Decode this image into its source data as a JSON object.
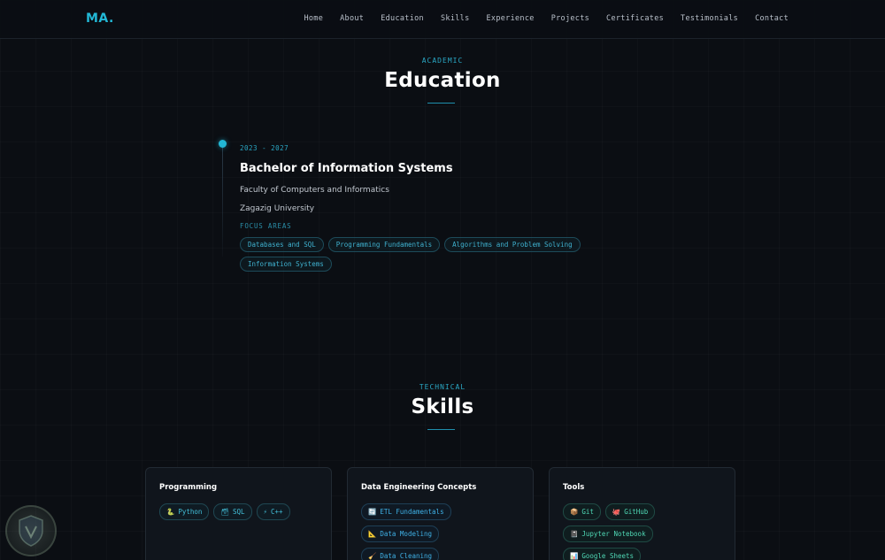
{
  "nav": {
    "logo": "MA.",
    "links": [
      "Home",
      "About",
      "Education",
      "Skills",
      "Experience",
      "Projects",
      "Certificates",
      "Testimonials",
      "Contact"
    ]
  },
  "education": {
    "eyebrow": "ACADEMIC",
    "title": "Education",
    "entry": {
      "years": "2023 - 2027",
      "degree": "Bachelor of Information Systems",
      "faculty": "Faculty of Computers and Informatics",
      "university": "Zagazig University",
      "focus_label": "FOCUS AREAS",
      "focus_areas": [
        "Databases and SQL",
        "Programming Fundamentals",
        "Algorithms and Problem Solving",
        "Information Systems"
      ]
    }
  },
  "skills": {
    "eyebrow": "TECHNICAL",
    "title": "Skills",
    "cards": [
      {
        "title": "Programming",
        "items": [
          {
            "icon": "🐍",
            "icon_name": "python-icon",
            "label": "Python"
          },
          {
            "icon": "🗃",
            "icon_name": "database-icon",
            "label": "SQL"
          },
          {
            "icon": "⚡",
            "icon_name": "lightning-icon",
            "label": "C++"
          }
        ]
      },
      {
        "title": "Data Engineering Concepts",
        "items": [
          {
            "icon": "🔄",
            "icon_name": "cycle-icon",
            "label": "ETL Fundamentals"
          },
          {
            "icon": "📐",
            "icon_name": "ruler-icon",
            "label": "Data Modeling"
          },
          {
            "icon": "🧹",
            "icon_name": "broom-icon",
            "label": "Data Cleaning"
          }
        ]
      },
      {
        "title": "Tools",
        "items": [
          {
            "icon": "📦",
            "icon_name": "package-icon",
            "label": "Git"
          },
          {
            "icon": "🐙",
            "icon_name": "octopus-icon",
            "label": "GitHub"
          },
          {
            "icon": "📓",
            "icon_name": "notebook-icon",
            "label": "Jupyter Notebook"
          },
          {
            "icon": "📊",
            "icon_name": "bar-chart-icon",
            "label": "Google Sheets"
          }
        ]
      }
    ]
  },
  "colors": {
    "background": "#0b0e13",
    "accent": "#22b8d6",
    "card_border": "#222a33"
  }
}
